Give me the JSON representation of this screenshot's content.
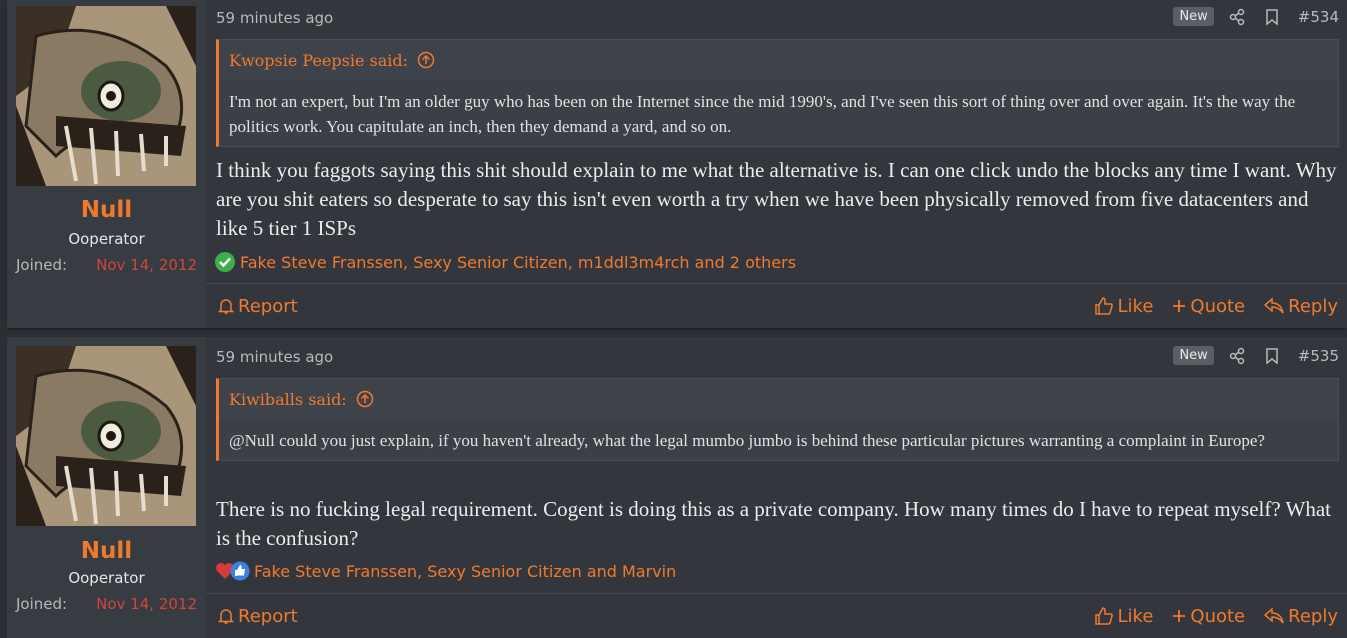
{
  "posts": [
    {
      "user": {
        "name": "Null",
        "title": "Ooperator",
        "joined_label": "Joined:",
        "joined_date": "Nov 14, 2012"
      },
      "time": "59 minutes ago",
      "badge": "New",
      "number": "#534",
      "quote": {
        "author": "Kwopsie Peepsie said:",
        "text": "I'm not an expert, but I'm an older guy who has been on the Internet since the mid 1990's, and I've seen this sort of thing over and over again. It's the way the politics work. You capitulate an inch, then they demand a yard, and so on."
      },
      "message": "I think you faggots saying this shit should explain to me what the alternative is. I can one click undo the blocks any time I want. Why are you shit eaters so desperate to say this isn't even worth a try when we have been physically removed from five datacenters and like 5 tier 1 ISPs",
      "reactions": {
        "icons": [
          "check-reaction-icon"
        ],
        "text": "Fake Steve Franssen, Sexy Senior Citizen, m1ddl3m4rch and 2 others"
      },
      "footer": {
        "report": "Report",
        "like": "Like",
        "quote": "Quote",
        "reply": "Reply"
      }
    },
    {
      "user": {
        "name": "Null",
        "title": "Ooperator",
        "joined_label": "Joined:",
        "joined_date": "Nov 14, 2012"
      },
      "time": "59 minutes ago",
      "badge": "New",
      "number": "#535",
      "quote": {
        "author": "Kiwiballs said:",
        "text": "@Null could you just explain, if you haven't already, what the legal mumbo jumbo is behind these particular pictures warranting a complaint in Europe?"
      },
      "message": "There is no fucking legal requirement. Cogent is doing this as a private company. How many times do I have to repeat myself? What is the confusion?",
      "reactions": {
        "icons": [
          "heart-reaction-icon",
          "thumbs-up-reaction-icon"
        ],
        "text": "Fake Steve Franssen, Sexy Senior Citizen and Marvin"
      },
      "footer": {
        "report": "Report",
        "like": "Like",
        "quote": "Quote",
        "reply": "Reply"
      }
    }
  ],
  "colors": {
    "accent": "#f07a2c",
    "joined_date": "#d2453a",
    "background": "#2b2e33",
    "panel": "#373b42"
  }
}
